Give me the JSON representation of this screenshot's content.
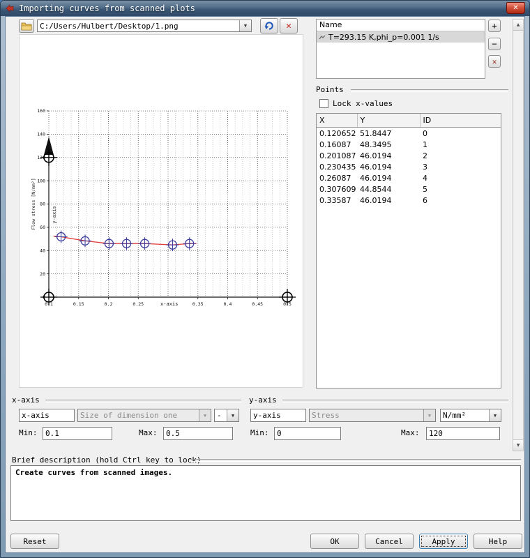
{
  "titlebar": {
    "title": "Importing curves from scanned plots",
    "close": "✕"
  },
  "toolbar": {
    "path_value": "C:/Users/Hulbert/Desktop/1.png"
  },
  "curves_panel": {
    "header": "Name",
    "items": [
      {
        "label": "T=293.15 K,phi_p=0.001 1/s"
      }
    ]
  },
  "points": {
    "group_title": "Points",
    "lock_label": "Lock x-values",
    "columns": [
      "X",
      "Y",
      "ID"
    ],
    "rows": [
      [
        "0.120652",
        "51.8447",
        "0"
      ],
      [
        "0.16087",
        "48.3495",
        "1"
      ],
      [
        "0.201087",
        "46.0194",
        "2"
      ],
      [
        "0.230435",
        "46.0194",
        "3"
      ],
      [
        "0.26087",
        "46.0194",
        "4"
      ],
      [
        "0.307609",
        "44.8544",
        "5"
      ],
      [
        "0.33587",
        "46.0194",
        "6"
      ]
    ]
  },
  "x_axis": {
    "group_title": "x-axis",
    "name_value": "x-axis",
    "quantity_value": "Size of dimension one",
    "unit_value": "-",
    "min_label": "Min:",
    "min_value": "0.1",
    "max_label": "Max:",
    "max_value": "0.5"
  },
  "y_axis": {
    "group_title": "y-axis",
    "name_value": "y-axis",
    "quantity_value": "Stress",
    "unit_value": "N/mm²",
    "min_label": "Min:",
    "min_value": "0",
    "max_label": "Max:",
    "max_value": "120"
  },
  "description": {
    "group_title": "Brief description (hold Ctrl key to lock)",
    "text": "Create curves from scanned images."
  },
  "actions": {
    "reset": "Reset",
    "ok": "OK",
    "cancel": "Cancel",
    "apply": "Apply",
    "help": "Help"
  },
  "plot": {
    "ylabel": "Flow stress [N/mm²]",
    "yaxis_caption": "y-axis",
    "xaxis_caption": "x-axis",
    "x_min": 0.1,
    "x_max": 0.5,
    "y_min": 0,
    "y_max": 160,
    "cal_y": 120,
    "cal_x": 0.5,
    "x_ticks": [
      0.1,
      0.15,
      0.2,
      0.25,
      0.35,
      0.4,
      0.45,
      0.5
    ],
    "y_ticks": [
      0,
      20,
      40,
      60,
      80,
      100,
      120,
      140,
      160
    ],
    "curve_color": "#e23b3b",
    "marker_color": "#3c3c9e",
    "points": [
      [
        0.120652,
        51.8447
      ],
      [
        0.16087,
        48.3495
      ],
      [
        0.201087,
        46.0194
      ],
      [
        0.230435,
        46.0194
      ],
      [
        0.26087,
        46.0194
      ],
      [
        0.307609,
        44.8544
      ],
      [
        0.33587,
        46.0194
      ]
    ]
  }
}
